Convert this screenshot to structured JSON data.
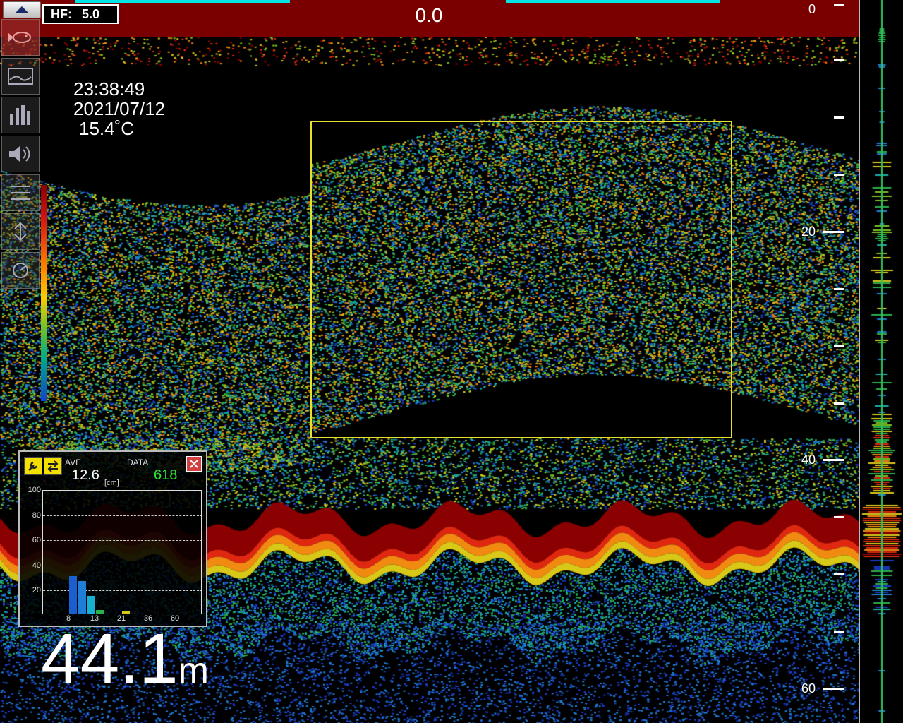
{
  "header": {
    "hf_label": "HF:",
    "hf_value": "5.0",
    "center_value": "0.0"
  },
  "toolbar": {
    "up_icon": "triangle-up-icon",
    "buttons": [
      {
        "icon": "fish-icon",
        "active": true
      },
      {
        "icon": "display-mode-icon",
        "active": false
      },
      {
        "icon": "histogram-icon",
        "active": false
      },
      {
        "icon": "speaker-icon",
        "active": false
      },
      {
        "icon": "range-icon",
        "active": false
      },
      {
        "icon": "shift-icon",
        "active": false
      },
      {
        "icon": "gain-icon",
        "active": false
      }
    ]
  },
  "status": {
    "time": "23:38:49",
    "date": "2021/07/12",
    "temperature": "15.4˚C"
  },
  "depth_scale": {
    "labels": [
      "0",
      "20",
      "40",
      "60"
    ],
    "max_depth": 60
  },
  "current_depth": {
    "value": "44.1",
    "unit": "m"
  },
  "histogram": {
    "ave_label": "AVE",
    "ave_value": "12.6",
    "ave_unit": "[cm]",
    "data_label": "DATA",
    "data_value": "618",
    "data_color": "#2ee82e",
    "y_ticks": [
      "100",
      "80",
      "60",
      "40",
      "20"
    ],
    "x_ticks": [
      "8",
      "13",
      "21",
      "36",
      "60"
    ],
    "bars_percent": [
      30,
      26,
      14,
      3,
      0,
      0,
      2,
      0
    ]
  },
  "colors": {
    "header_bg": "#7a0000",
    "selection": "#e6e02a",
    "bottom_echo": "#8b0000"
  }
}
